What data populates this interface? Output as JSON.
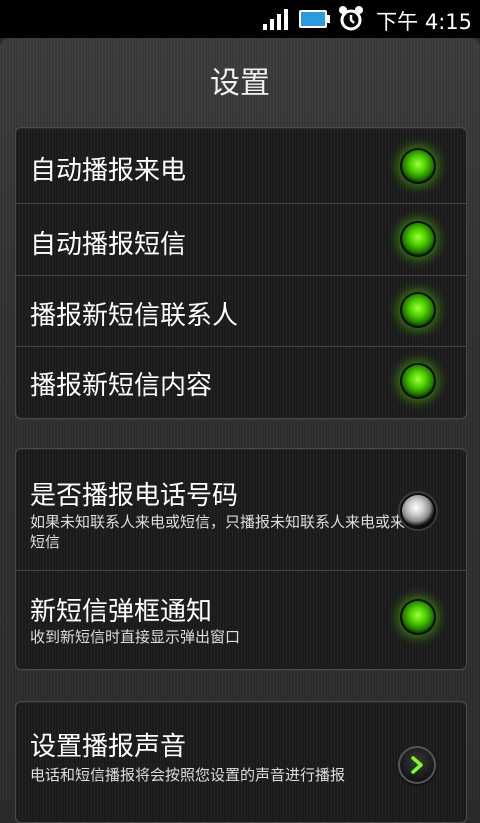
{
  "status_bar": {
    "time": "下午 4:15",
    "icons": [
      "signal-icon",
      "battery-icon",
      "alarm-icon"
    ]
  },
  "header": {
    "title": "设置"
  },
  "group1": {
    "items": [
      {
        "label": "自动播报来电",
        "toggle": true
      },
      {
        "label": "自动播报短信",
        "toggle": true
      },
      {
        "label": "播报新短信联系人",
        "toggle": true
      },
      {
        "label": "播报新短信内容",
        "toggle": true
      }
    ]
  },
  "group2": {
    "items": [
      {
        "label": "是否播报电话号码",
        "desc": "如果未知联系人来电或短信，只播报未知联系人来电或来短信",
        "toggle": false
      },
      {
        "label": "新短信弹框通知",
        "desc": "收到新短信时直接显示弹出窗口",
        "toggle": true
      }
    ]
  },
  "group3": {
    "items": [
      {
        "label": "设置播报声音",
        "desc": "电话和短信播报将会按照您设置的声音进行播报"
      }
    ]
  },
  "colors": {
    "led_on": "#4ccf00",
    "accent": "#7dff1a"
  }
}
